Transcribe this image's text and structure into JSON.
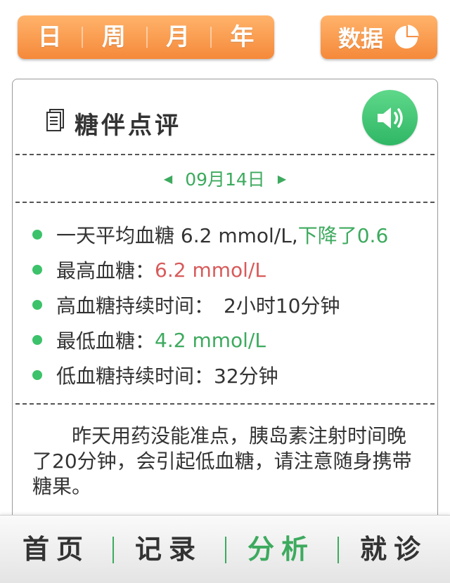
{
  "period_tabs": [
    "日",
    "周",
    "月",
    "年"
  ],
  "data_button": {
    "label": "数据",
    "icon": "pie-chart-icon"
  },
  "card": {
    "title": "糖伴点评",
    "title_icon": "document-icon",
    "speaker_icon": "speaker-icon",
    "date": "09月14日",
    "stats": {
      "avg_label": "一天平均血糖 6.2 mmol/L,",
      "avg_trend": "下降了0.6",
      "max_label": "最高血糖：",
      "max_value": "6.2 mmol/L",
      "high_duration_label": "高血糖持续时间：",
      "high_duration_value": "2小时10分钟",
      "min_label": "最低血糖：",
      "min_value": "4.2 mmol/L",
      "low_duration_label": "低血糖持续时间：",
      "low_duration_value": "32分钟"
    },
    "comment": "昨天用药没能准点，胰岛素注射时间晚了20分钟，会引起低血糖，请注意随身携带糖果。"
  },
  "bottom_nav": {
    "items": [
      "首页",
      "记录",
      "分析",
      "就诊"
    ],
    "active": "分析"
  },
  "colors": {
    "accent_orange": "#f5893a",
    "accent_green": "#3daa5e",
    "alert_red": "#d85a5a"
  }
}
